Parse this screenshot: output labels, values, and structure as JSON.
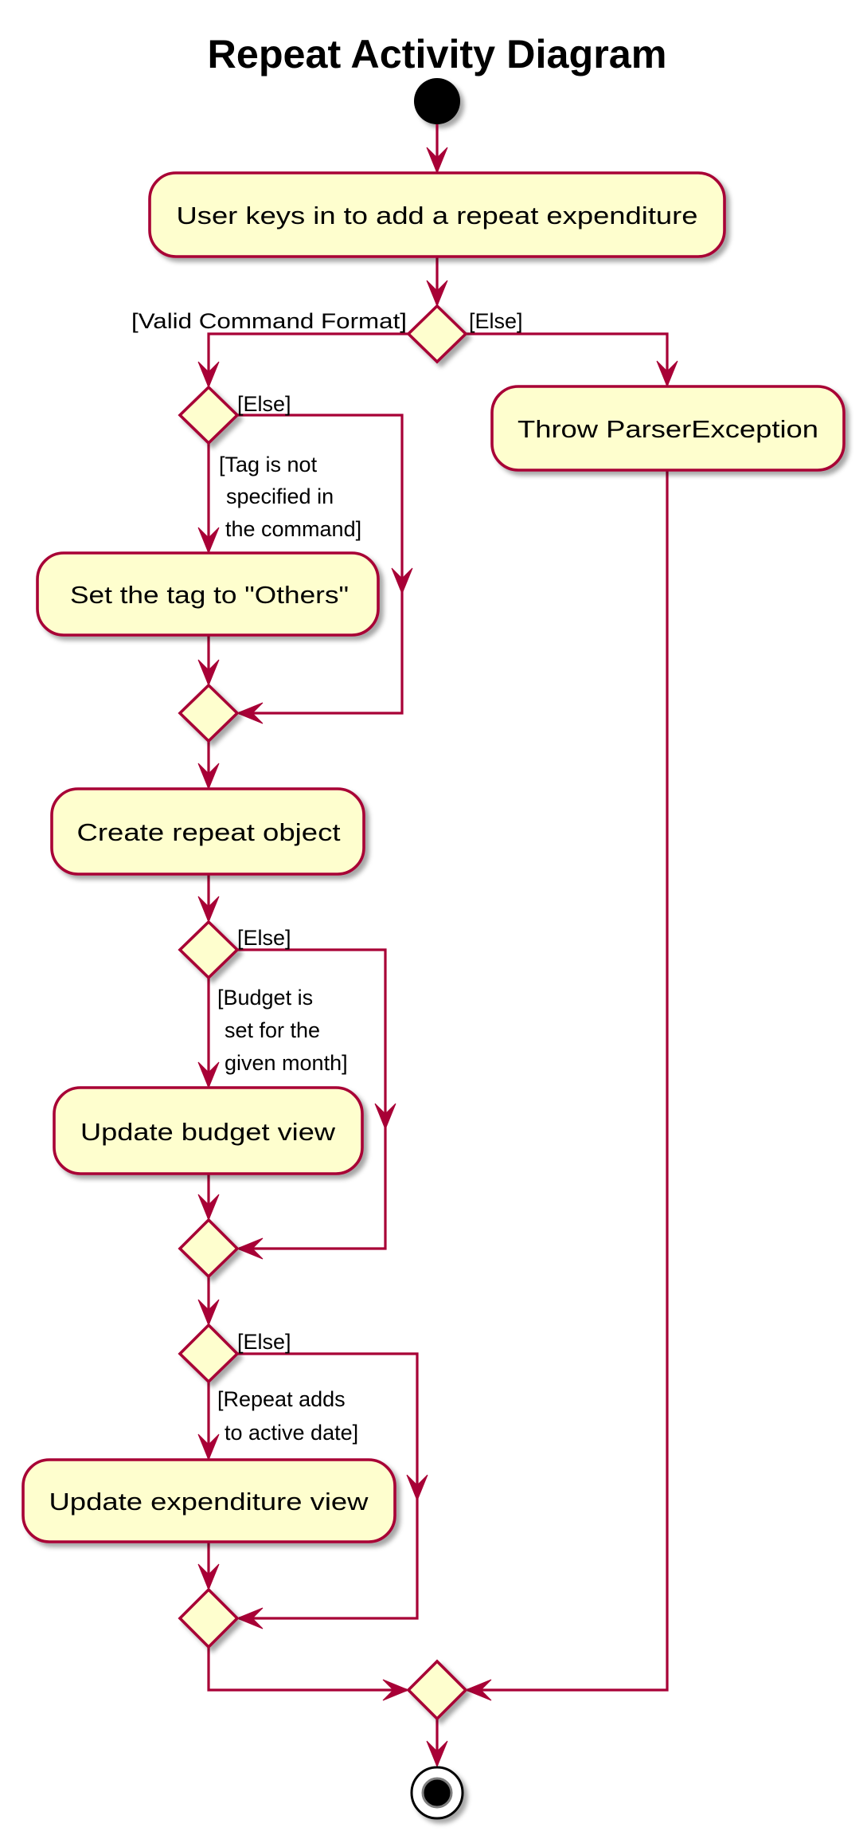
{
  "diagram": {
    "title": "Repeat Activity Diagram",
    "colors": {
      "line": "#A80036",
      "activity_fill": "#FEFECE",
      "activity_border": "#A80036",
      "text": "#000000",
      "start_node": "#000000"
    },
    "activities": {
      "user_input": "User keys in to add a repeat expenditure",
      "throw_exception": "Throw ParserException",
      "set_tag": "Set the tag to \"Others\"",
      "create_repeat": "Create repeat object",
      "update_budget": "Update budget view",
      "update_expenditure": "Update expenditure view"
    },
    "decisions": {
      "command_format": {
        "yes_guard": "[Valid Command Format]",
        "else_guard": "[Else]"
      },
      "tag_check": {
        "yes_guard_lines": [
          "[Tag is not",
          "specified in",
          "the command]"
        ],
        "else_guard": "[Else]"
      },
      "budget_check": {
        "yes_guard_lines": [
          "[Budget is",
          "set for the",
          "given month]"
        ],
        "else_guard": "[Else]"
      },
      "active_date_check": {
        "yes_guard_lines": [
          "[Repeat adds",
          "to active date]"
        ],
        "else_guard": "[Else]"
      }
    }
  }
}
